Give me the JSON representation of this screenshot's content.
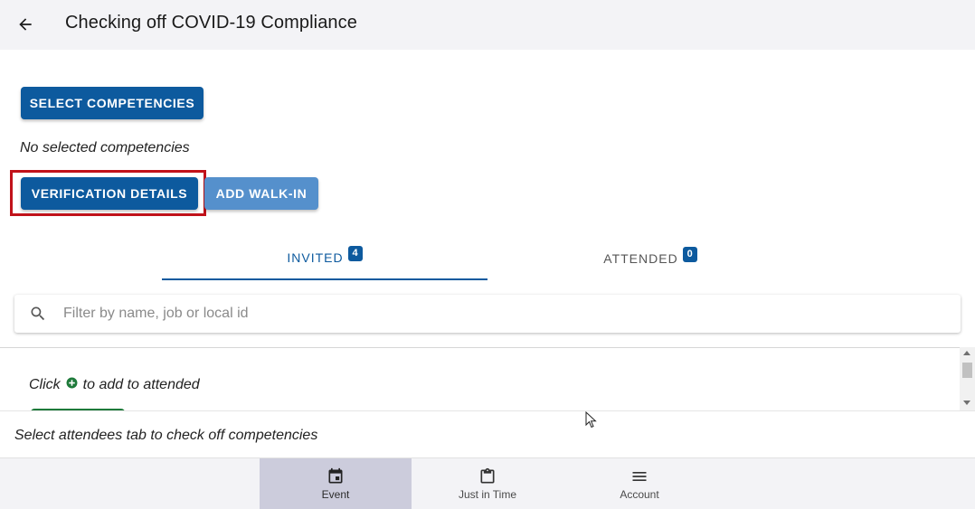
{
  "header": {
    "title": "Checking off COVID-19 Compliance",
    "back_icon": "arrow-left-icon"
  },
  "actions": {
    "select_competencies_label": "SELECT COMPETENCIES",
    "no_selected_text": "No selected competencies",
    "verification_details_label": "VERIFICATION DETAILS",
    "add_walk_in_label": "ADD WALK-IN"
  },
  "tabs": [
    {
      "label": "INVITED",
      "count": "4",
      "active": true
    },
    {
      "label": "ATTENDED",
      "count": "0",
      "active": false
    }
  ],
  "search": {
    "placeholder": "Filter by name, job or local id",
    "value": ""
  },
  "list": {
    "hint_prefix": "Click",
    "hint_suffix": "to add to attended"
  },
  "footer": {
    "hint": "Select attendees tab to check off competencies"
  },
  "bottom_nav": [
    {
      "label": "Event",
      "icon": "calendar-icon",
      "active": true
    },
    {
      "label": "Just in Time",
      "icon": "clipboard-icon",
      "active": false
    },
    {
      "label": "Account",
      "icon": "menu-icon",
      "active": false
    }
  ],
  "colors": {
    "primary": "#0d5a9e",
    "primary_light": "#5590cc",
    "highlight": "#c1121a",
    "success": "#1e7a3a",
    "nav_active_bg": "#ccccdc"
  }
}
